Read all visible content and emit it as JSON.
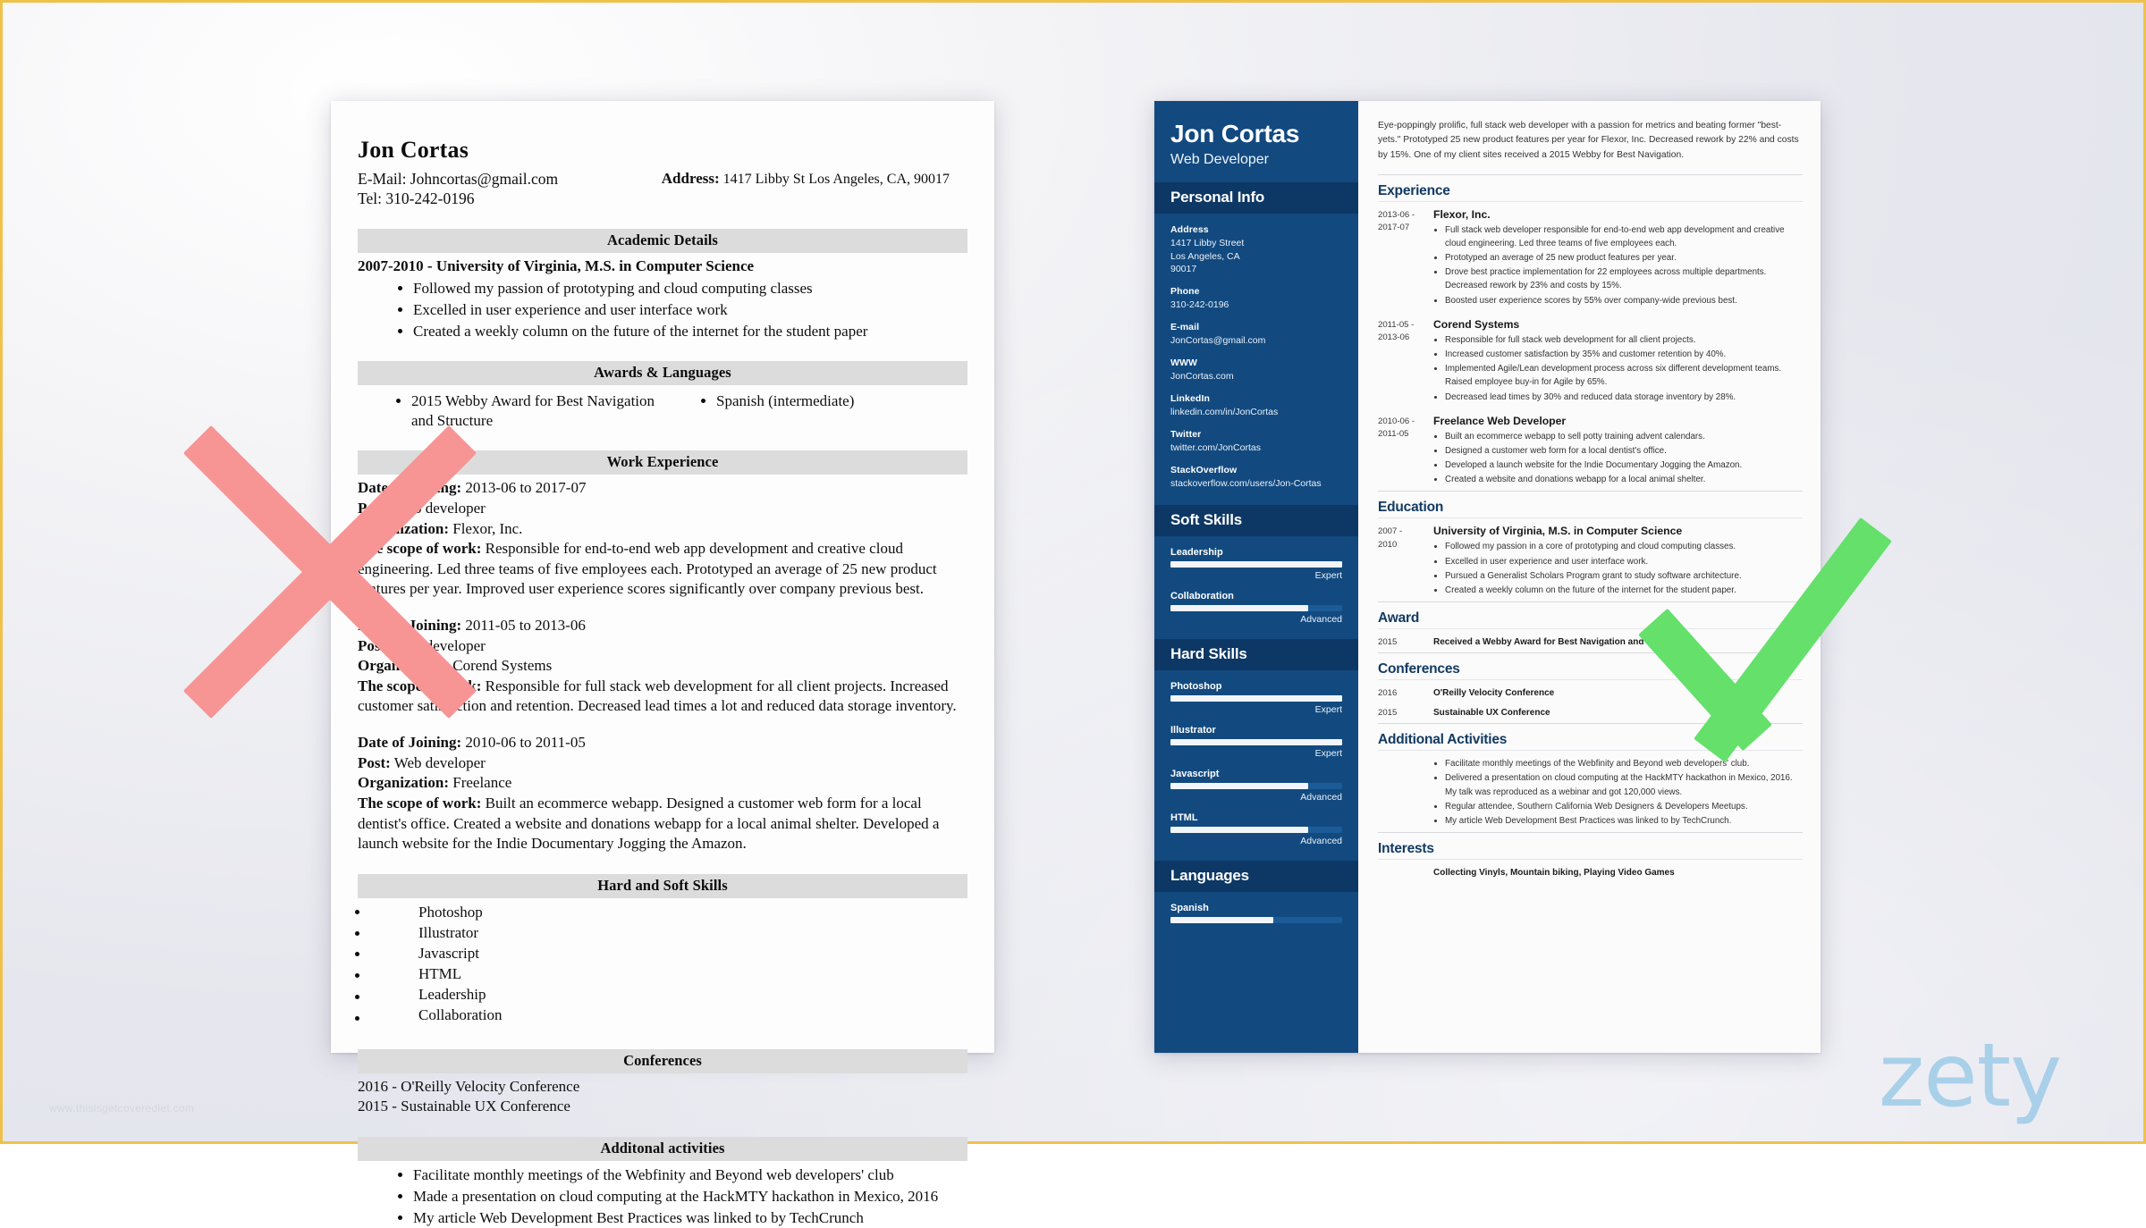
{
  "left_resume": {
    "name": "Jon Cortas",
    "email_line": "E-Mail: Johncortas@gmail.com",
    "tel_line": "Tel: 310-242-0196",
    "address_label": "Address:",
    "address_value": "1417 Libby St Los Angeles, CA, 90017",
    "sections": {
      "academic": {
        "title": "Academic Details",
        "heading": "2007-2010 - University of Virginia, M.S. in Computer Science",
        "bullets": [
          "Followed my passion of prototyping and cloud computing classes",
          "Excelled in user experience and user interface work",
          "Created a weekly column on the future of the internet for the student paper"
        ]
      },
      "awards": {
        "title": "Awards & Languages",
        "left_bullets": [
          "2015 Webby Award for Best Navigation and Structure"
        ],
        "right_bullets": [
          "Spanish (intermediate)"
        ]
      },
      "work": {
        "title": "Work Experience",
        "jobs": [
          {
            "date": "Date of Joining: 2013-06 to 2017-07",
            "date_label": "Date of Joining:",
            "date_value": " 2013-06 to 2017-07",
            "post_label": "Post:",
            "post_value": " Web developer",
            "org_label": "Organization:",
            "org_value": " Flexor, Inc.",
            "scope_label": "The scope of work:",
            "scope_value": " Responsible for end-to-end web app development and creative cloud engineering. Led three teams of five employees each. Prototyped an average of 25 new product features per year. Improved user experience scores significantly over company previous best."
          },
          {
            "date_label": "Date of Joining:",
            "date_value": " 2011-05 to 2013-06",
            "post_label": "Post:",
            "post_value": " Web developer",
            "org_label": "Organization:",
            "org_value": " Corend Systems",
            "scope_label": "The scope of work:",
            "scope_value": " Responsible for full stack web development for all client projects. Increased customer satisfaction and retention. Decreased lead times a lot and reduced data storage inventory."
          },
          {
            "date_label": "Date of Joining:",
            "date_value": " 2010-06 to 2011-05",
            "post_label": "Post:",
            "post_value": " Web developer",
            "org_label": "Organization:",
            "org_value": "  Freelance",
            "scope_label": "The scope of work:",
            "scope_value": " Built an ecommerce webapp. Designed a customer web form for a local dentist's office. Created a website and donations webapp for a local animal shelter. Developed a launch website for the Indie Documentary Jogging the Amazon."
          }
        ]
      },
      "skills": {
        "title": "Hard and Soft Skills",
        "items": [
          "Photoshop",
          "Illustrator",
          "Javascript",
          "HTML",
          "Leadership",
          "Collaboration"
        ]
      },
      "conferences": {
        "title": "Conferences",
        "items": [
          "2016 - O'Reilly Velocity Conference",
          "2015 - Sustainable UX Conference"
        ]
      },
      "additional": {
        "title": "Additonal activities",
        "items": [
          "Facilitate monthly meetings of the Webfinity and Beyond web developers' club",
          "Made a presentation on cloud computing at the HackMTY hackathon in Mexico, 2016",
          "My article Web Development Best Practices was linked to by TechCrunch"
        ]
      }
    }
  },
  "right_resume": {
    "sidebar": {
      "name": "Jon Cortas",
      "role": "Web Developer",
      "personal_info_title": "Personal Info",
      "personal_info": [
        {
          "label": "Address",
          "value": "1417 Libby Street\nLos Angeles, CA\n90017"
        },
        {
          "label": "Phone",
          "value": "310-242-0196"
        },
        {
          "label": "E-mail",
          "value": "JonCortas@gmail.com"
        },
        {
          "label": "WWW",
          "value": "JonCortas.com"
        },
        {
          "label": "LinkedIn",
          "value": "linkedin.com/in/JonCortas"
        },
        {
          "label": "Twitter",
          "value": "twitter.com/JonCortas"
        },
        {
          "label": "StackOverflow",
          "value": "stackoverflow.com/users/Jon-Cortas"
        }
      ],
      "soft_skills_title": "Soft Skills",
      "soft_skills": [
        {
          "name": "Leadership",
          "level": "Expert",
          "percent": 100
        },
        {
          "name": "Collaboration",
          "level": "Advanced",
          "percent": 80
        }
      ],
      "hard_skills_title": "Hard Skills",
      "hard_skills": [
        {
          "name": "Photoshop",
          "level": "Expert",
          "percent": 100
        },
        {
          "name": "Illustrator",
          "level": "Expert",
          "percent": 100
        },
        {
          "name": "Javascript",
          "level": "Advanced",
          "percent": 80
        },
        {
          "name": "HTML",
          "level": "Advanced",
          "percent": 80
        }
      ],
      "languages_title": "Languages",
      "languages": [
        {
          "name": "Spanish",
          "level": "",
          "percent": 60
        }
      ]
    },
    "main": {
      "summary": "Eye-poppingly prolific, full stack web developer with a passion for metrics and beating former \"best-yets.\" Prototyped 25 new product features per year for Flexor, Inc. Decreased rework by 22% and costs by 15%. One of my client sites received a 2015 Webby for Best Navigation.",
      "experience_title": "Experience",
      "experience": [
        {
          "date": "2013-06 -\n2017-07",
          "title": "Flexor, Inc.",
          "bullets": [
            "Full stack web developer responsible for end-to-end web app development and creative cloud engineering. Led three teams of five employees each.",
            "Prototyped an average of 25 new product features per year.",
            "Drove best practice implementation for 22 employees across multiple departments. Decreased rework by 23% and costs by 15%.",
            "Boosted user experience scores by 55% over company-wide previous best."
          ]
        },
        {
          "date": "2011-05 -\n2013-06",
          "title": "Corend Systems",
          "bullets": [
            "Responsible for full stack web development for all client projects.",
            "Increased customer satisfaction by 35% and customer retention by 40%.",
            "Implemented Agile/Lean development process across six different development teams. Raised employee buy-in for Agile by 65%.",
            "Decreased lead times by 30% and reduced data storage inventory by 28%."
          ]
        },
        {
          "date": "2010-06 -\n2011-05",
          "title": "Freelance Web Developer",
          "bullets": [
            "Built an ecommerce webapp to sell potty training advent calendars.",
            "Designed a customer web form for a local dentist's office.",
            "Developed a launch website for the Indie Documentary Jogging the Amazon.",
            "Created a website and donations webapp for a local animal shelter."
          ]
        }
      ],
      "education_title": "Education",
      "education": [
        {
          "date": "2007 -\n2010",
          "title": "University of Virginia, M.S. in Computer Science",
          "bullets": [
            "Followed my passion in a core of prototyping and cloud computing classes.",
            "Excelled in user experience and user interface work.",
            "Pursued a Generalist Scholars Program grant to study software architecture.",
            "Created a weekly column on the future of the internet for the student paper."
          ]
        }
      ],
      "award_title": "Award",
      "award": [
        {
          "date": "2015",
          "text": "Received a Webby Award for Best Navigation and Structure."
        }
      ],
      "conferences_title": "Conferences",
      "conferences": [
        {
          "date": "2016",
          "text": "O'Reilly Velocity Conference"
        },
        {
          "date": "2015",
          "text": "Sustainable UX Conference"
        }
      ],
      "additional_title": "Additional Activities",
      "additional": [
        "Facilitate monthly meetings of the Webfinity and Beyond web developers' club.",
        "Delivered a presentation on cloud computing at the HackMTY hackathon in Mexico, 2016. My talk was reproduced as a webinar and got 120,000 views.",
        "Regular attendee, Southern California Web Designers & Developers Meetups.",
        "My article Web Development Best Practices was linked to by TechCrunch."
      ],
      "interests_title": "Interests",
      "interests": "Collecting Vinyls, Mountain biking, Playing Video Games"
    }
  },
  "overlay": {
    "reject_mark": "x-mark",
    "approve_mark": "check-mark",
    "reject_color": "#F79494",
    "approve_color": "#64E06B"
  },
  "branding": {
    "logo": "zety",
    "logo_color": "#9ecbe8",
    "watermark": "www.thisisgetcoveredlet.com"
  }
}
